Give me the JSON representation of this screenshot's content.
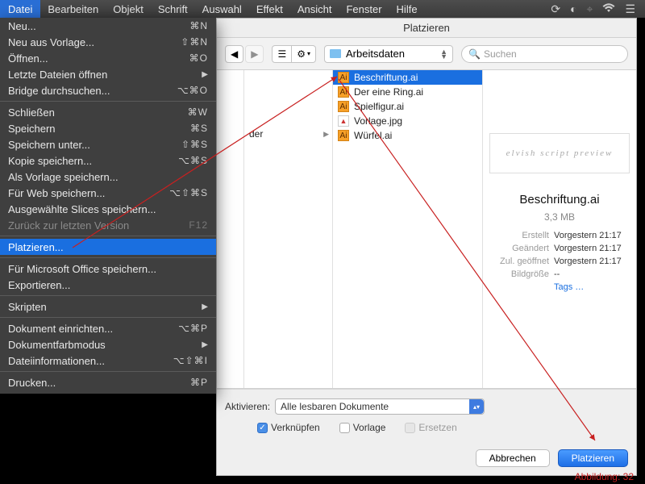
{
  "menubar": {
    "active": "Datei",
    "items": [
      "Datei",
      "Bearbeiten",
      "Objekt",
      "Schrift",
      "Auswahl",
      "Effekt",
      "Ansicht",
      "Fenster",
      "Hilfe"
    ],
    "status_icons": [
      "sync-icon",
      "help-icon",
      "bluetooth-icon",
      "wifi-icon",
      "control-center-icon"
    ]
  },
  "dropdown": {
    "sections": [
      [
        {
          "label": "Neu...",
          "shortcut": "⌘N"
        },
        {
          "label": "Neu aus Vorlage...",
          "shortcut": "⇧⌘N"
        },
        {
          "label": "Öffnen...",
          "shortcut": "⌘O"
        },
        {
          "label": "Letzte Dateien öffnen",
          "submenu": true
        },
        {
          "label": "Bridge durchsuchen...",
          "shortcut": "⌥⌘O"
        }
      ],
      [
        {
          "label": "Schließen",
          "shortcut": "⌘W"
        },
        {
          "label": "Speichern",
          "shortcut": "⌘S"
        },
        {
          "label": "Speichern unter...",
          "shortcut": "⇧⌘S"
        },
        {
          "label": "Kopie speichern...",
          "shortcut": "⌥⌘S"
        },
        {
          "label": "Als Vorlage speichern..."
        },
        {
          "label": "Für Web speichern...",
          "shortcut": "⌥⇧⌘S"
        },
        {
          "label": "Ausgewählte Slices speichern..."
        },
        {
          "label": "Zurück zur letzten Version",
          "shortcut": "F12",
          "disabled": true
        }
      ],
      [
        {
          "label": "Platzieren...",
          "highlight": true
        }
      ],
      [
        {
          "label": "Für Microsoft Office speichern..."
        },
        {
          "label": "Exportieren..."
        }
      ],
      [
        {
          "label": "Skripten",
          "submenu": true
        }
      ],
      [
        {
          "label": "Dokument einrichten...",
          "shortcut": "⌥⌘P"
        },
        {
          "label": "Dokumentfarbmodus",
          "submenu": true
        },
        {
          "label": "Dateiinformationen...",
          "shortcut": "⌥⇧⌘I"
        }
      ],
      [
        {
          "label": "Drucken...",
          "shortcut": "⌘P"
        }
      ]
    ]
  },
  "dialog": {
    "title": "Platzieren",
    "location": "Arbeitsdaten",
    "search_placeholder": "Suchen",
    "sidebar_visible_item": "der",
    "files": [
      {
        "name": "Beschriftung.ai",
        "icon": "ai",
        "selected": true
      },
      {
        "name": "Der eine Ring.ai",
        "icon": "ai"
      },
      {
        "name": "Spielfigur.ai",
        "icon": "ai"
      },
      {
        "name": "Vorlage.jpg",
        "icon": "img"
      },
      {
        "name": "Würfel.ai",
        "icon": "ai"
      }
    ],
    "preview": {
      "name": "Beschriftung.ai",
      "size": "3,3 MB",
      "meta": [
        {
          "k": "Erstellt",
          "v": "Vorgestern 21:17"
        },
        {
          "k": "Geändert",
          "v": "Vorgestern 21:17"
        },
        {
          "k": "Zul. geöffnet",
          "v": "Vorgestern 21:17"
        },
        {
          "k": "Bildgröße",
          "v": "--"
        },
        {
          "k": "",
          "v": "Tags …",
          "tags": true
        }
      ]
    },
    "enable_label": "Aktivieren:",
    "enable_value": "Alle lesbaren Dokumente",
    "checkboxes": {
      "link": {
        "label": "Verknüpfen",
        "checked": true
      },
      "template": {
        "label": "Vorlage",
        "checked": false
      },
      "replace": {
        "label": "Ersetzen",
        "checked": false,
        "disabled": true
      }
    },
    "buttons": {
      "cancel": "Abbrechen",
      "ok": "Platzieren"
    }
  },
  "caption": "Abbildung: 32"
}
